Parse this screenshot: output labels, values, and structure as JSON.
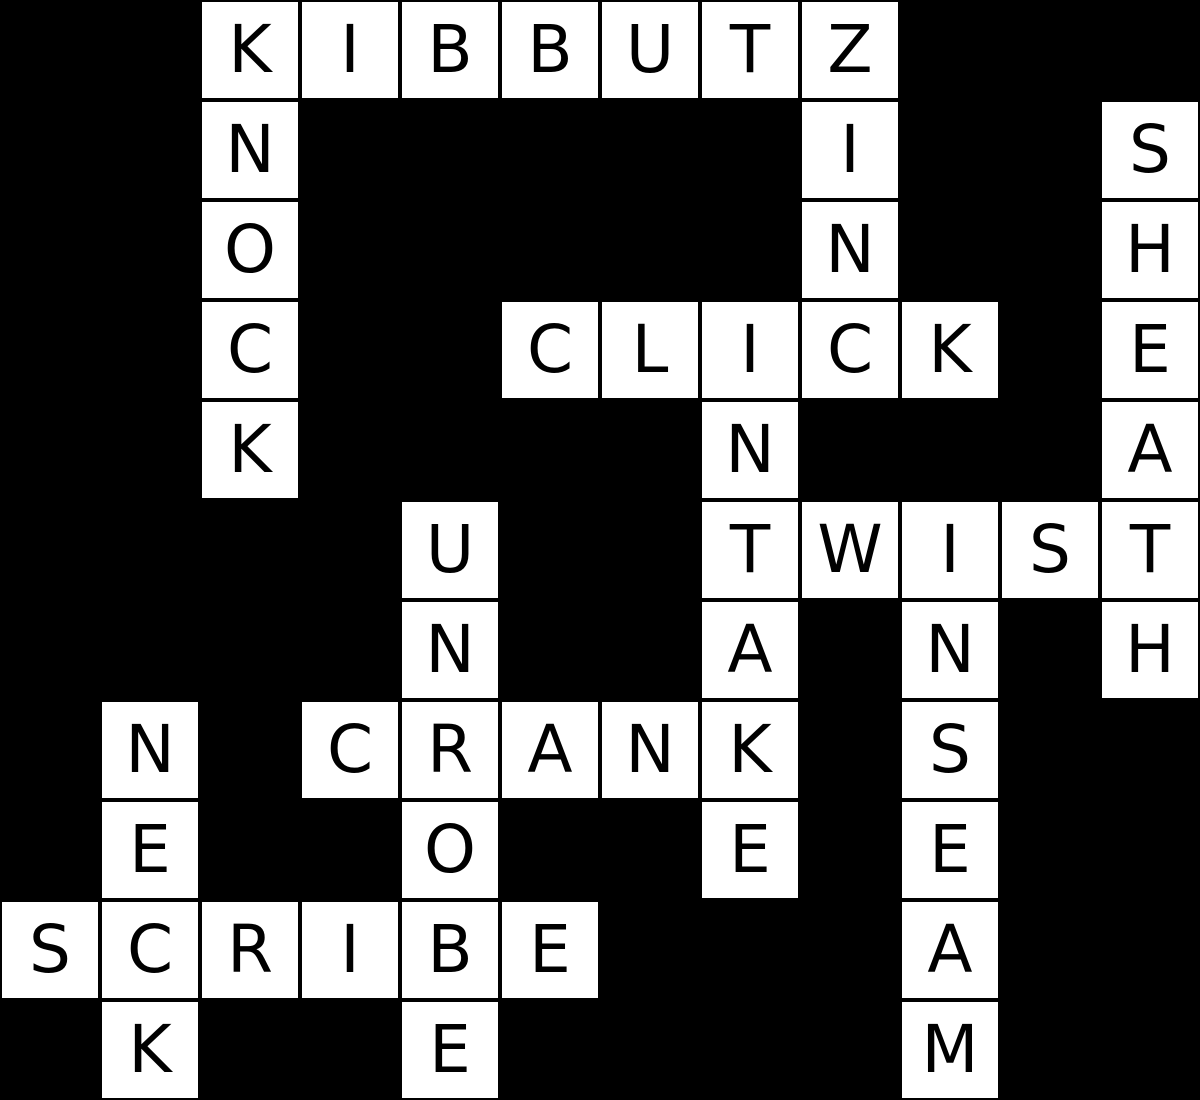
{
  "puzzle": {
    "rows": 11,
    "cols": 12,
    "grid": [
      "..KIBBUTZ...",
      "..N.....I..S",
      "..O.....N..H",
      "..C..CLICK.E",
      "..K....N...A",
      "....U..TWIST",
      "....N..A.N.H",
      ".N.CRANK.S..",
      ".E..O..E.E..",
      "SCRIBE...A..",
      ".K..E....M.."
    ],
    "words": [
      "KIBBUTZ",
      "KNOCK",
      "ZINC",
      "SHEATH",
      "CLICK",
      "INTAKE",
      "TWIST",
      "UNROBE",
      "INSEAM",
      "CRANK",
      "NECK",
      "SCRIBE"
    ]
  },
  "colors": {
    "background": "#000000",
    "cell": "#ffffff",
    "letter": "#000000"
  }
}
